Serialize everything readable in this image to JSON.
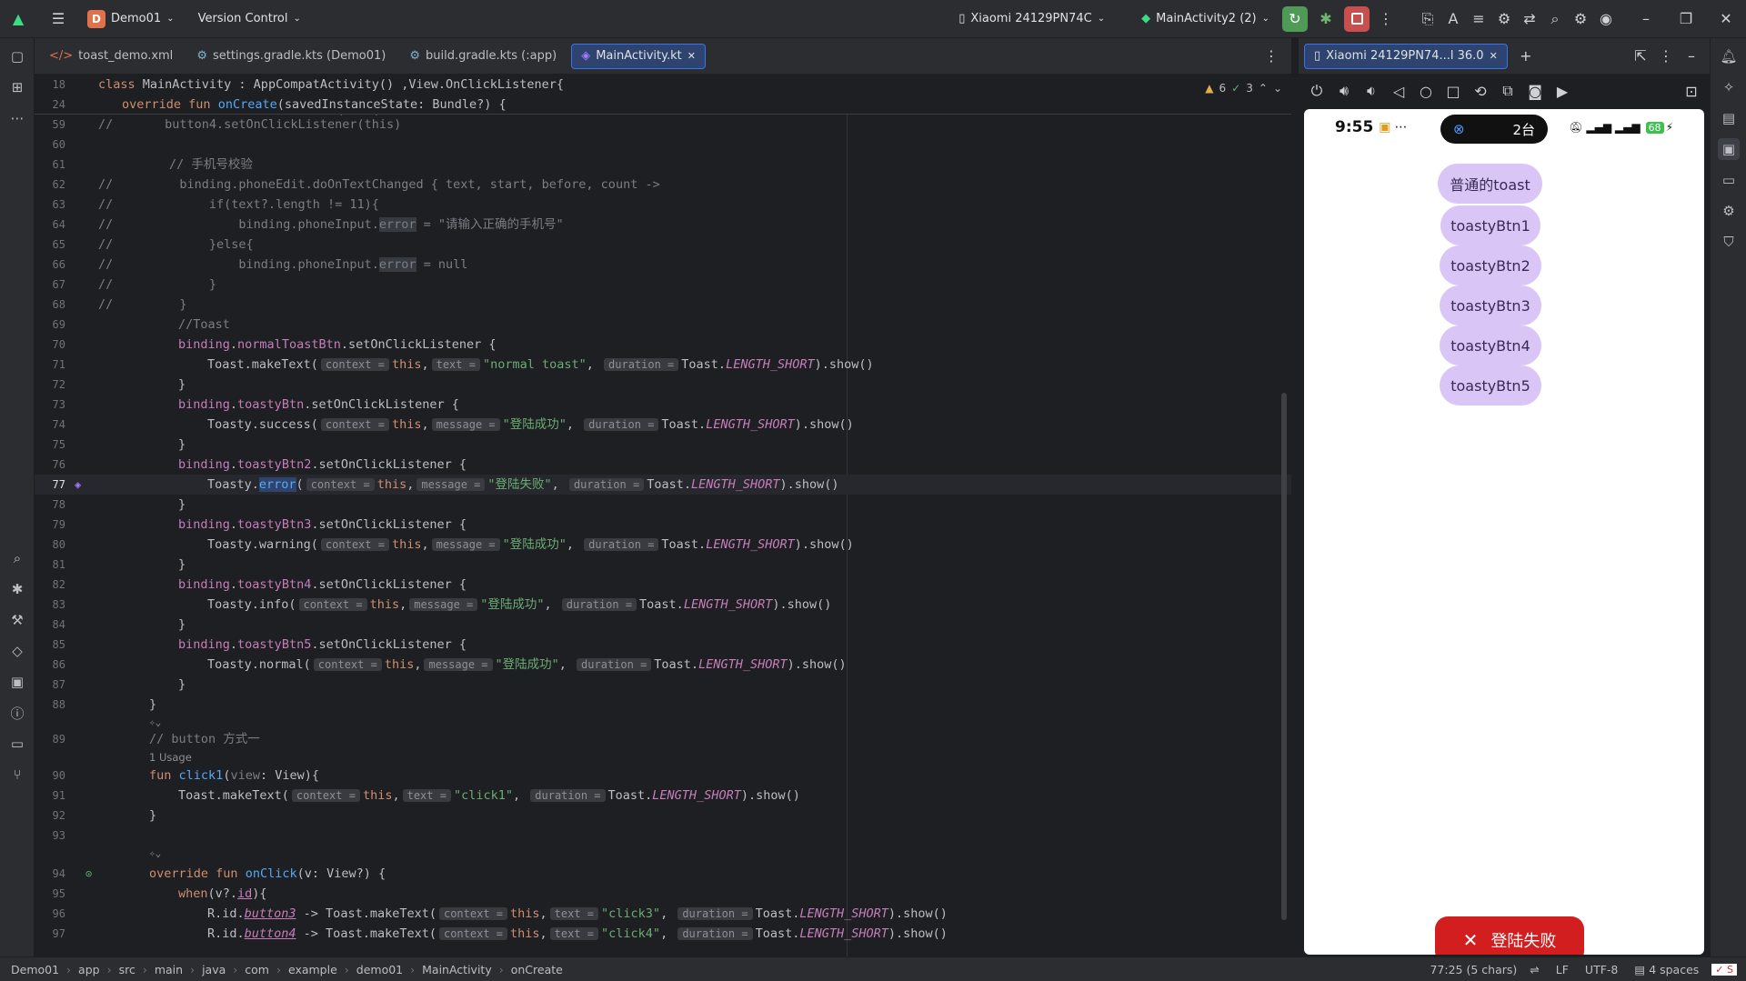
{
  "topbar": {
    "project_initial": "D",
    "project_name": "Demo01",
    "vcs_label": "Version Control",
    "device": "Xiaomi 24129PN74C",
    "run_config": "MainActivity2 (2)"
  },
  "tabs": [
    {
      "label": "toast_demo.xml",
      "icon": "xml-icon"
    },
    {
      "label": "settings.gradle.kts (Demo01)",
      "icon": "gradle-icon"
    },
    {
      "label": "build.gradle.kts (:app)",
      "icon": "gradle-icon"
    },
    {
      "label": "MainActivity.kt",
      "icon": "kotlin-icon",
      "active": true
    }
  ],
  "inspections": {
    "warnings": "6",
    "checks": "3"
  },
  "code": {
    "sticky1_num": "18",
    "sticky2_num": "24",
    "l59": "59",
    "l60": "60",
    "l61": "61",
    "l62": "62",
    "l63": "63",
    "l64": "64",
    "l65": "65",
    "l66": "66",
    "l67": "67",
    "l68": "68",
    "l69": "69",
    "l70": "70",
    "l71": "71",
    "l72": "72",
    "l73": "73",
    "l74": "74",
    "l75": "75",
    "l76": "76",
    "l77": "77",
    "l78": "78",
    "l79": "79",
    "l80": "80",
    "l81": "81",
    "l82": "82",
    "l83": "83",
    "l84": "84",
    "l85": "85",
    "l86": "86",
    "l87": "87",
    "l88": "88",
    "l89": "89",
    "l90": "90",
    "l91": "91",
    "l92": "92",
    "l93": "93",
    "l94": "94",
    "l95": "95",
    "l96": "96",
    "l97": "97",
    "usage": "1 Usage"
  },
  "emulator": {
    "tab_label": "Xiaomi 24129PN74...l 36.0",
    "time": "9:55",
    "island_text": "2台",
    "battery": "68",
    "buttons": [
      "普通的toast",
      "toastyBtn1",
      "toastyBtn2",
      "toastyBtn3",
      "toastyBtn4",
      "toastyBtn5"
    ],
    "toast_text": "登陆失败"
  },
  "breadcrumb": [
    "Demo01",
    "app",
    "src",
    "main",
    "java",
    "com",
    "example",
    "demo01",
    "MainActivity",
    "onCreate"
  ],
  "status": {
    "position": "77:25 (5 chars)",
    "line_sep": "LF",
    "encoding": "UTF-8",
    "indent": "4 spaces"
  },
  "colors": {
    "accent": "#3574f0",
    "run_green": "#4e9a56",
    "stop_red": "#c94f4f",
    "toast_red": "#d21e1e",
    "button_lilac": "#d9c6f7"
  }
}
